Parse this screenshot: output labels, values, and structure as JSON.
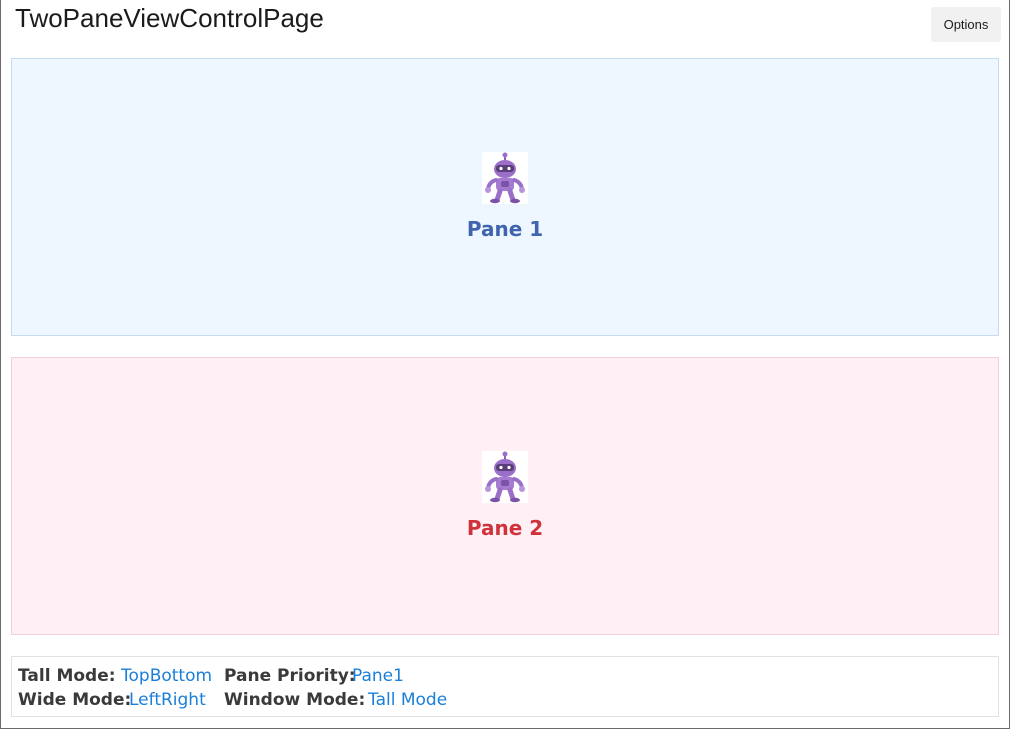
{
  "header": {
    "title": "TwoPaneViewControlPage",
    "options_label": "Options"
  },
  "panes": [
    {
      "label": "Pane 1",
      "icon": "dotnet-bot-icon",
      "background": "#eef6ff",
      "label_color": "#3f63ad"
    },
    {
      "label": "Pane 2",
      "icon": "dotnet-bot-icon",
      "background": "#fff0f5",
      "label_color": "#d1313a"
    }
  ],
  "status": {
    "tall_mode_label": "Tall Mode:",
    "tall_mode_value": "TopBottom",
    "pane_priority_label": "Pane Priority:",
    "pane_priority_value": "Pane1",
    "wide_mode_label": "Wide Mode:",
    "wide_mode_value": "LeftRight",
    "window_mode_label": "Window Mode:",
    "window_mode_value": "Tall Mode"
  },
  "colors": {
    "link_blue": "#1a7fd8",
    "label_gray": "#3a3a3a"
  }
}
